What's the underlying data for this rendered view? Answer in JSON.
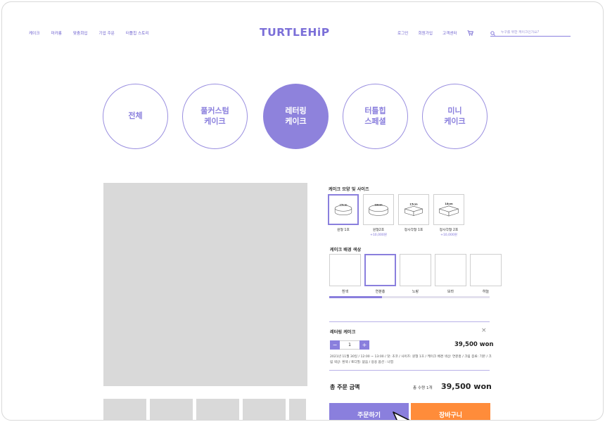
{
  "header": {
    "nav_left": [
      "케이크",
      "마카롱",
      "맞춤회입",
      "기업 주문",
      "터틀힙 스토리"
    ],
    "logo": "TURTLEHiP",
    "nav_right": [
      "로그인",
      "회원가입",
      "고객센터"
    ],
    "search_placeholder": "누구를 위한 케이크인가요?"
  },
  "categories": [
    {
      "label": "전체",
      "active": false
    },
    {
      "label": "풀커스텀\n케이크",
      "active": false
    },
    {
      "label": "레터링\n케이크",
      "active": true
    },
    {
      "label": "터틀힙\n스페셜",
      "active": false
    },
    {
      "label": "미니\n케이크",
      "active": false
    }
  ],
  "options": {
    "shape_title": "케이크 모양 및 사이즈",
    "shapes": [
      {
        "name": "원형 1호",
        "size": "15cm",
        "price": "",
        "selected": true
      },
      {
        "name": "원형2호",
        "size": "18cm",
        "price": "+10,000원",
        "selected": false
      },
      {
        "name": "정사각형 1호",
        "size": "15cm",
        "price": "",
        "selected": false
      },
      {
        "name": "정사각형 2호",
        "size": "18cm",
        "price": "+10,000원",
        "selected": false
      }
    ],
    "color_title": "케이크 배경 색상",
    "colors": [
      {
        "name": "흰색",
        "selected": false
      },
      {
        "name": "연분홍",
        "selected": true
      },
      {
        "name": "노랑",
        "selected": false
      },
      {
        "name": "보라",
        "selected": false
      },
      {
        "name": "하늘",
        "selected": false
      }
    ],
    "scroll_progress": 0.33
  },
  "cart_item": {
    "name": "레터링 케이크",
    "quantity": "1",
    "minus": "−",
    "plus": "+",
    "close": "×",
    "price": "39,500 won",
    "detail": "2021년 11월 30일 / 12:00 ~ 13:00 / 맛: 초코 / 사이즈: 원형 1호 / 케이크 배경 색상: 연분홍 / 크림 종류: 기본 / 크림 색상: 흰색 / 토디필: 없음 / 용용 옵션 : 나엽"
  },
  "totals": {
    "label": "총 주문 금액",
    "count": "총 수량 1개",
    "price": "39,500 won"
  },
  "buttons": {
    "order": "주문하기",
    "cart": "장바구니"
  },
  "colors": {
    "accent": "#8a7fdd",
    "cart_button": "#ff8c3a",
    "placeholder_gray": "#d9d9d9"
  }
}
